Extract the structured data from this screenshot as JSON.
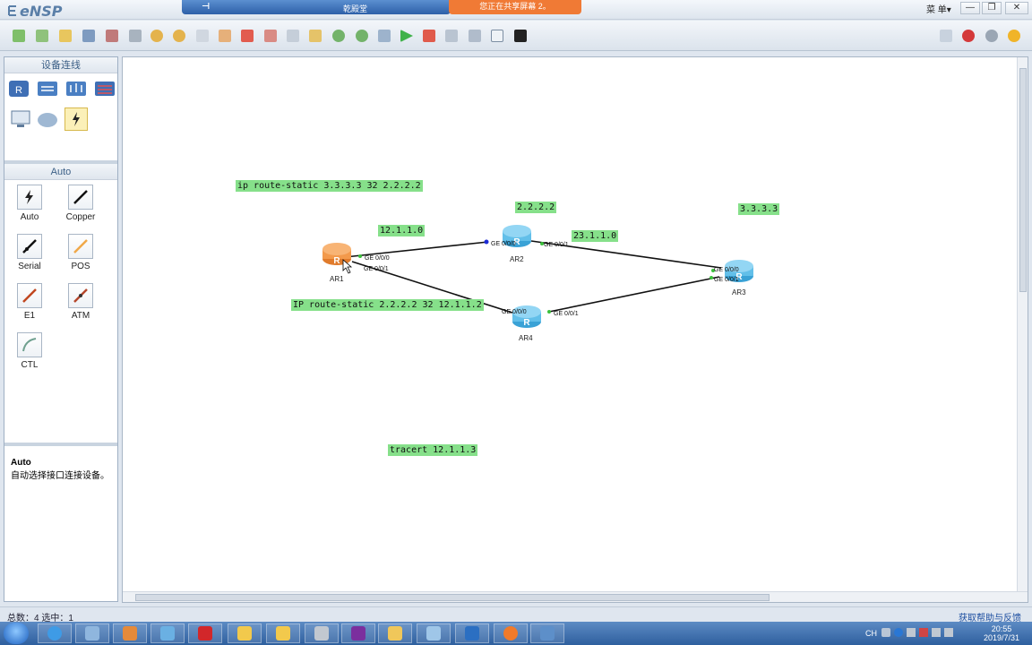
{
  "app": {
    "title": "eNSP",
    "share_presenter": "乾殿堂",
    "share_notice": "您正在共享屏幕 2。",
    "menu_label": "菜 单▾"
  },
  "window_buttons": [
    "—",
    "❐",
    "✕"
  ],
  "panel": {
    "header": "设备连线",
    "section_title": "Auto",
    "tools": [
      {
        "label": "Auto",
        "icon": "auto-connect-icon"
      },
      {
        "label": "Copper",
        "icon": "copper-cable-icon"
      },
      {
        "label": "Serial",
        "icon": "serial-cable-icon"
      },
      {
        "label": "POS",
        "icon": "pos-cable-icon"
      },
      {
        "label": "E1",
        "icon": "e1-cable-icon"
      },
      {
        "label": "ATM",
        "icon": "atm-cable-icon"
      },
      {
        "label": "CTL",
        "icon": "ctl-cable-icon"
      }
    ],
    "info_title": "Auto",
    "info_desc": "自动选择接口连接设备。"
  },
  "topology": {
    "notes": {
      "ar1_route": "ip route-static 3.3.3.3 32 2.2.2.2",
      "ar2_loopback": "2.2.2.2",
      "ar3_loopback": "3.3.3.3",
      "link_12": "12.1.1.0",
      "link_23": "23.1.1.0",
      "ar4_route": "IP route-static 2.2.2.2 32 12.1.1.2",
      "tracert": "tracert 12.1.1.3"
    },
    "routers": {
      "ar1": "AR1",
      "ar2": "AR2",
      "ar3": "AR3",
      "ar4": "AR4"
    },
    "ports": {
      "ar1_g000": "GE 0/0/0",
      "ar1_g001": "GE 0/0/1",
      "ar2_g000": "GE 0/0/0",
      "ar2_g001": "GE 0/0/1",
      "ar3_g000": "GE 0/0/0",
      "ar3_g001": "GE 0/0/1",
      "ar4_g000": "GE 0/0/0",
      "ar4_g001": "GE 0/0/1"
    }
  },
  "status": {
    "counts": "总数：4 选中：1",
    "help_link": "获取帮助与反馈"
  },
  "taskbar": {
    "lang": "CH",
    "time": "20:55",
    "date": "2019/7/31"
  },
  "colors": {
    "note_bg": "#86e08a",
    "router_selected": "#f39a4c",
    "router_blue": "#6cc6ef"
  }
}
